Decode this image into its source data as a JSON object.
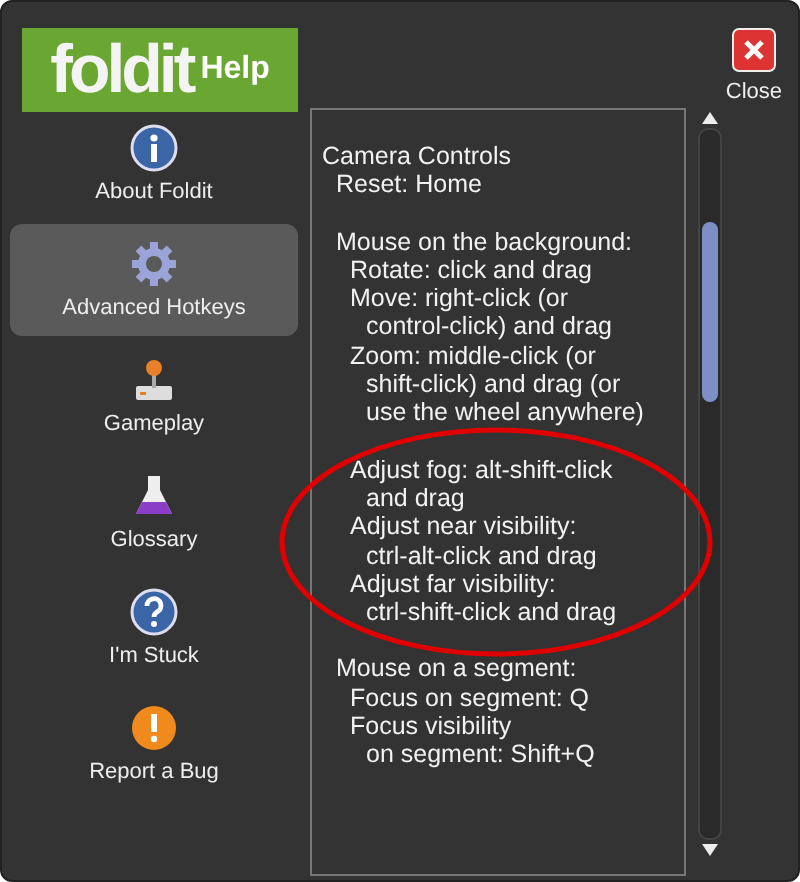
{
  "logo": {
    "word": "foldit",
    "suffix": "Help"
  },
  "close_button": {
    "label": "Close"
  },
  "sidebar": {
    "items": [
      {
        "label": "About Foldit",
        "kind": "info",
        "selected": false
      },
      {
        "label": "Advanced Hotkeys",
        "kind": "gear",
        "selected": true
      },
      {
        "label": "Gameplay",
        "kind": "joystick",
        "selected": false
      },
      {
        "label": "Glossary",
        "kind": "flask",
        "selected": false
      },
      {
        "label": "I'm Stuck",
        "kind": "question",
        "selected": false
      },
      {
        "label": "Report a Bug",
        "kind": "warning",
        "selected": false
      }
    ]
  },
  "content": {
    "title": "Camera Controls",
    "children": [
      {
        "lines": [
          "Reset: Home"
        ]
      },
      {
        "gap_before": true,
        "lines": [
          "Mouse on the background:"
        ],
        "children": [
          {
            "lines": [
              "Rotate: click and drag"
            ]
          },
          {
            "lines": [
              "Move: right-click (or",
              "control-click) and drag"
            ]
          },
          {
            "lines": [
              "Zoom: middle-click (or",
              "shift-click) and drag (or",
              "use the wheel anywhere)"
            ]
          },
          {
            "gap_before": true,
            "lines": [
              "Adjust fog: alt-shift-click",
              "and drag"
            ]
          },
          {
            "lines": [
              "Adjust near visibility:",
              "ctrl-alt-click and drag"
            ]
          },
          {
            "lines": [
              "Adjust far visibility:",
              "ctrl-shift-click and drag"
            ]
          }
        ]
      },
      {
        "gap_before": true,
        "lines": [
          "Mouse on a segment:"
        ],
        "children": [
          {
            "lines": [
              "Focus on segment: Q"
            ]
          },
          {
            "lines": [
              "Focus visibility",
              "on segment: Shift+Q"
            ]
          }
        ]
      }
    ]
  },
  "highlight": {
    "kind": "ellipse",
    "color": "#e00000"
  }
}
